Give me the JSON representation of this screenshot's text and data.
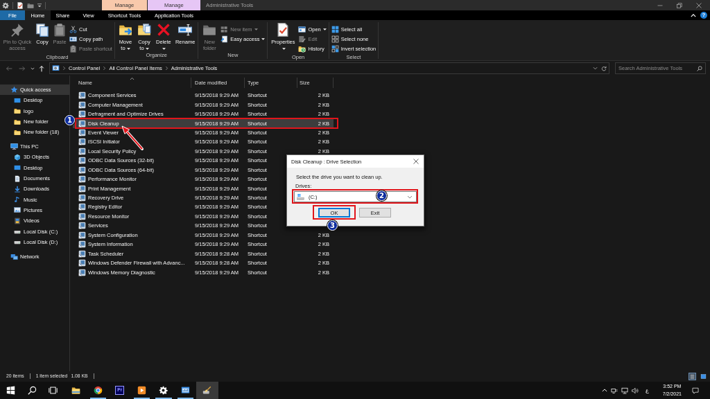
{
  "title_bar": {
    "context_tabs": [
      {
        "label": "Manage",
        "color": "#f8c9ab"
      },
      {
        "label": "Manage",
        "color": "#e6c6f5"
      }
    ],
    "title": "Administrative Tools"
  },
  "ribbon": {
    "tabs": [
      {
        "label": "File",
        "kind": "file",
        "selected": false
      },
      {
        "label": "Home",
        "kind": "tab",
        "selected": true
      },
      {
        "label": "Share",
        "kind": "tab",
        "selected": false
      },
      {
        "label": "View",
        "kind": "tab",
        "selected": false
      },
      {
        "label": "Shortcut Tools",
        "kind": "tab",
        "selected": false
      },
      {
        "label": "Application Tools",
        "kind": "tab",
        "selected": false
      }
    ],
    "help": "?",
    "groups": [
      {
        "label": "Clipboard",
        "buttons": [
          {
            "label": "Pin to Quick access",
            "kind": "large",
            "disabled": true,
            "dropdown": false
          },
          {
            "label": "Copy",
            "kind": "large",
            "disabled": false,
            "dropdown": false
          },
          {
            "label": "Paste",
            "kind": "large",
            "disabled": true,
            "dropdown": false
          },
          {
            "label": "Cut",
            "kind": "small",
            "disabled": false,
            "dropdown": false
          },
          {
            "label": "Copy path",
            "kind": "small",
            "disabled": false,
            "dropdown": false
          },
          {
            "label": "Paste shortcut",
            "kind": "small",
            "disabled": true,
            "dropdown": false
          }
        ]
      },
      {
        "label": "Organize",
        "buttons": [
          {
            "label": "Move to",
            "kind": "large",
            "disabled": false,
            "dropdown": true
          },
          {
            "label": "Copy to",
            "kind": "large",
            "disabled": false,
            "dropdown": true
          },
          {
            "label": "Delete",
            "kind": "large",
            "disabled": false,
            "dropdown": true
          },
          {
            "label": "Rename",
            "kind": "large",
            "disabled": false,
            "dropdown": false
          }
        ]
      },
      {
        "label": "New",
        "buttons": [
          {
            "label": "New folder",
            "kind": "large",
            "disabled": true,
            "dropdown": false
          },
          {
            "label": "New item",
            "kind": "small",
            "disabled": true,
            "dropdown": true
          },
          {
            "label": "Easy access",
            "kind": "small",
            "disabled": false,
            "dropdown": true
          }
        ]
      },
      {
        "label": "Open",
        "buttons": [
          {
            "label": "Properties",
            "kind": "large",
            "disabled": false,
            "dropdown": true
          },
          {
            "label": "Open",
            "kind": "small",
            "disabled": false,
            "dropdown": true
          },
          {
            "label": "Edit",
            "kind": "small",
            "disabled": true,
            "dropdown": false
          },
          {
            "label": "History",
            "kind": "small",
            "disabled": false,
            "dropdown": false
          }
        ]
      },
      {
        "label": "Select",
        "buttons": [
          {
            "label": "Select all",
            "kind": "small",
            "disabled": false,
            "dropdown": false
          },
          {
            "label": "Select none",
            "kind": "small",
            "disabled": false,
            "dropdown": false
          },
          {
            "label": "Invert selection",
            "kind": "small",
            "disabled": false,
            "dropdown": false
          }
        ]
      }
    ]
  },
  "address_bar": {
    "nav_buttons": [
      {
        "kind": "back",
        "disabled": true
      },
      {
        "kind": "forward",
        "disabled": true
      },
      {
        "kind": "recent",
        "disabled": false
      },
      {
        "kind": "up",
        "disabled": false
      }
    ],
    "path": [
      "Control Panel",
      "All Control Panel Items",
      "Administrative Tools"
    ]
  },
  "search": {
    "placeholder": "Search Administrative Tools"
  },
  "navigation_pane": {
    "items": [
      {
        "label": "Quick access",
        "kind": "star",
        "selected": true,
        "children": [
          {
            "label": "Desktop",
            "kind": "desktop",
            "selected": false
          },
          {
            "label": "logo",
            "kind": "folder",
            "selected": false
          },
          {
            "label": "New folder",
            "kind": "folder",
            "selected": false
          },
          {
            "label": "New folder (18)",
            "kind": "folder",
            "selected": false
          }
        ]
      },
      {
        "label": "This PC",
        "kind": "pc",
        "selected": false,
        "children": [
          {
            "label": "3D Objects",
            "kind": "cube",
            "selected": false
          },
          {
            "label": "Desktop",
            "kind": "desktop",
            "selected": false
          },
          {
            "label": "Documents",
            "kind": "document",
            "selected": false
          },
          {
            "label": "Downloads",
            "kind": "download",
            "selected": false
          },
          {
            "label": "Music",
            "kind": "music",
            "selected": false
          },
          {
            "label": "Pictures",
            "kind": "picture",
            "selected": false
          },
          {
            "label": "Videos",
            "kind": "video",
            "selected": false
          },
          {
            "label": "Local Disk (C:)",
            "kind": "drive",
            "selected": false
          },
          {
            "label": "Local Disk (D:)",
            "kind": "drive",
            "selected": false
          }
        ]
      },
      {
        "label": "Network",
        "kind": "network",
        "selected": false
      }
    ]
  },
  "file_list": {
    "columns": [
      {
        "label": "Name",
        "sorted": true
      },
      {
        "label": "Date modified",
        "sorted": false
      },
      {
        "label": "Type",
        "sorted": false
      },
      {
        "label": "Size",
        "sorted": false
      }
    ],
    "rows": [
      {
        "name": "Component Services",
        "date_modified": "9/15/2018 9:29 AM",
        "type": "Shortcut",
        "size": "2 KB",
        "selected": false
      },
      {
        "name": "Computer Management",
        "date_modified": "9/15/2018 9:29 AM",
        "type": "Shortcut",
        "size": "2 KB",
        "selected": false
      },
      {
        "name": "Defragment and Optimize Drives",
        "date_modified": "9/15/2018 9:29 AM",
        "type": "Shortcut",
        "size": "2 KB",
        "selected": false
      },
      {
        "name": "Disk Cleanup",
        "date_modified": "9/15/2018 9:29 AM",
        "type": "Shortcut",
        "size": "2 KB",
        "selected": true,
        "callout": "1"
      },
      {
        "name": "Event Viewer",
        "date_modified": "9/15/2018 9:29 AM",
        "type": "Shortcut",
        "size": "2 KB",
        "selected": false
      },
      {
        "name": "iSCSI Initiator",
        "date_modified": "9/15/2018 9:29 AM",
        "type": "Shortcut",
        "size": "2 KB",
        "selected": false
      },
      {
        "name": "Local Security Policy",
        "date_modified": "9/15/2018 9:29 AM",
        "type": "Shortcut",
        "size": "2 KB",
        "selected": false
      },
      {
        "name": "ODBC Data Sources (32-bit)",
        "date_modified": "9/15/2018 9:29 AM",
        "type": "Shortcut",
        "selected": false
      },
      {
        "name": "ODBC Data Sources (64-bit)",
        "date_modified": "9/15/2018 9:29 AM",
        "type": "Shortcut",
        "selected": false
      },
      {
        "name": "Performance Monitor",
        "date_modified": "9/15/2018 9:29 AM",
        "type": "Shortcut",
        "selected": false
      },
      {
        "name": "Print Management",
        "date_modified": "9/15/2018 9:29 AM",
        "type": "Shortcut",
        "selected": false
      },
      {
        "name": "Recovery Drive",
        "date_modified": "9/15/2018 9:29 AM",
        "type": "Shortcut",
        "selected": false
      },
      {
        "name": "Registry Editor",
        "date_modified": "9/15/2018 9:29 AM",
        "type": "Shortcut",
        "selected": false
      },
      {
        "name": "Resource Monitor",
        "date_modified": "9/15/2018 9:29 AM",
        "type": "Shortcut",
        "selected": false
      },
      {
        "name": "Services",
        "date_modified": "9/15/2018 9:29 AM",
        "type": "Shortcut",
        "selected": false
      },
      {
        "name": "System Configuration",
        "date_modified": "9/15/2018 9:29 AM",
        "type": "Shortcut",
        "size": "2 KB",
        "selected": false
      },
      {
        "name": "System Information",
        "date_modified": "9/15/2018 9:29 AM",
        "type": "Shortcut",
        "size": "2 KB",
        "selected": false
      },
      {
        "name": "Task Scheduler",
        "date_modified": "9/15/2018 9:28 AM",
        "type": "Shortcut",
        "size": "2 KB",
        "selected": false
      },
      {
        "name": "Windows Defender Firewall with Advanc...",
        "date_modified": "9/15/2018 9:28 AM",
        "type": "Shortcut",
        "size": "2 KB",
        "selected": false
      },
      {
        "name": "Windows Memory Diagnostic",
        "date_modified": "9/15/2018 9:29 AM",
        "type": "Shortcut",
        "size": "2 KB",
        "selected": false
      }
    ]
  },
  "dialog": {
    "title": "Disk Cleanup : Drive Selection",
    "prompt": "Select the drive you want to clean up.",
    "field_label": "Drives:",
    "drive": {
      "value": "(C:)",
      "callout": "2"
    },
    "buttons": [
      {
        "label": "OK",
        "default": true,
        "callout": "3"
      },
      {
        "label": "Exit",
        "default": false
      }
    ]
  },
  "status_bar": {
    "item_count": "20 items",
    "selection": "1 item selected",
    "selection_size": "1.08 KB",
    "views": [
      {
        "kind": "details",
        "selected": true
      },
      {
        "kind": "tiles",
        "selected": false
      }
    ]
  },
  "taskbar": {
    "apps": [
      {
        "kind": "folder",
        "running": false,
        "active": false
      },
      {
        "kind": "browser",
        "running": true,
        "active": false
      },
      {
        "kind": "video-editor",
        "glyph": "Pr",
        "running": false,
        "active": false
      },
      {
        "kind": "media-player",
        "running": true,
        "active": false
      },
      {
        "kind": "settings",
        "running": true,
        "active": false
      },
      {
        "kind": "control-panel",
        "running": true,
        "active": false
      },
      {
        "kind": "cleanup",
        "running": false,
        "active": true
      }
    ],
    "tray": {
      "language": "ع",
      "time": "3:52 PM",
      "date": "7/2/2021"
    }
  }
}
